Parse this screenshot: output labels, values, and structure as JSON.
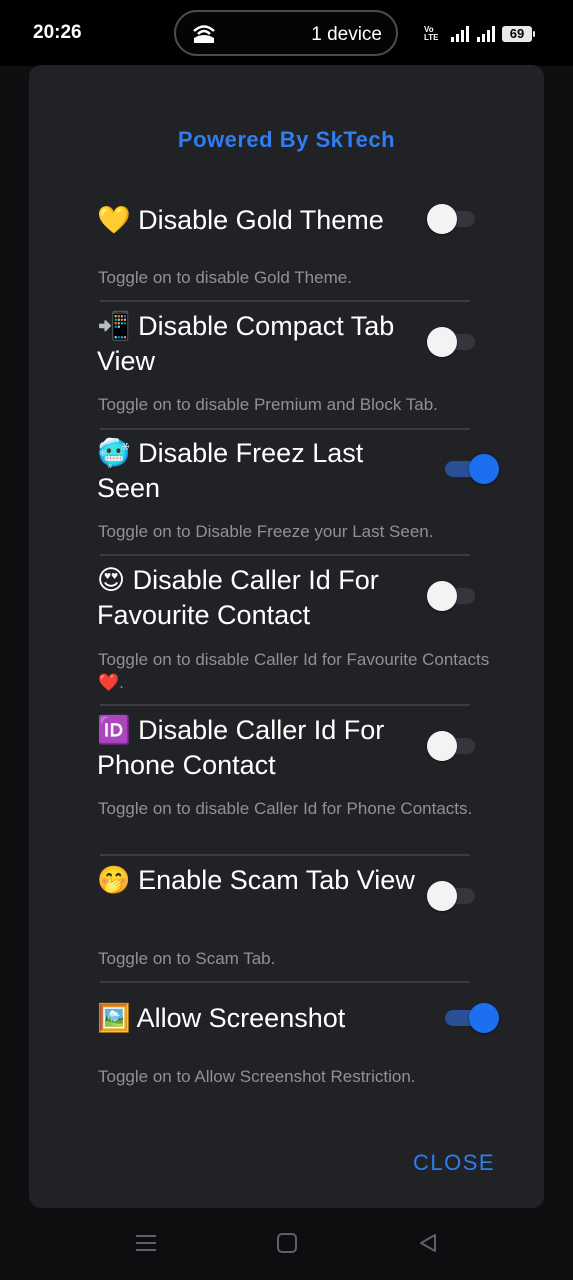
{
  "status_bar": {
    "time": "20:26",
    "device_text": "1 device",
    "volte_top": "Vo",
    "volte_bottom": "LTE",
    "battery": "69"
  },
  "dialog": {
    "powered_by": "Powered By SkTech",
    "close_label": "CLOSE",
    "accent_color": "#2f7df0",
    "settings": [
      {
        "emoji": "💛",
        "title": "Disable Gold Theme",
        "desc": "Toggle on to disable Gold Theme.",
        "enabled": false
      },
      {
        "emoji": "📲",
        "title": "Disable Compact Tab View",
        "desc": "Toggle on to disable Premium and Block Tab.",
        "enabled": false
      },
      {
        "emoji": "🥶",
        "title": "Disable Freez Last Seen",
        "desc": "Toggle on to Disable Freeze your Last Seen.",
        "enabled": true
      },
      {
        "emoji": "😍",
        "title": "Disable Caller Id For Favourite Contact",
        "desc": "Toggle on to disable Caller Id for Favourite Contacts❤️.",
        "enabled": false
      },
      {
        "emoji": "🆔",
        "title": "Disable Caller Id For Phone Contact",
        "desc": "Toggle on to disable Caller Id for Phone Contacts.",
        "enabled": false
      },
      {
        "emoji": "🤭",
        "title": "Enable Scam Tab View",
        "desc": "Toggle on to Scam Tab.",
        "enabled": false
      },
      {
        "emoji": "🖼️",
        "title": "Allow Screenshot",
        "desc": "Toggle on to Allow Screenshot Restriction.",
        "enabled": true
      }
    ]
  },
  "nav_bar": {
    "icons": [
      "menu-icon",
      "home-square-icon",
      "back-triangle-icon"
    ]
  }
}
